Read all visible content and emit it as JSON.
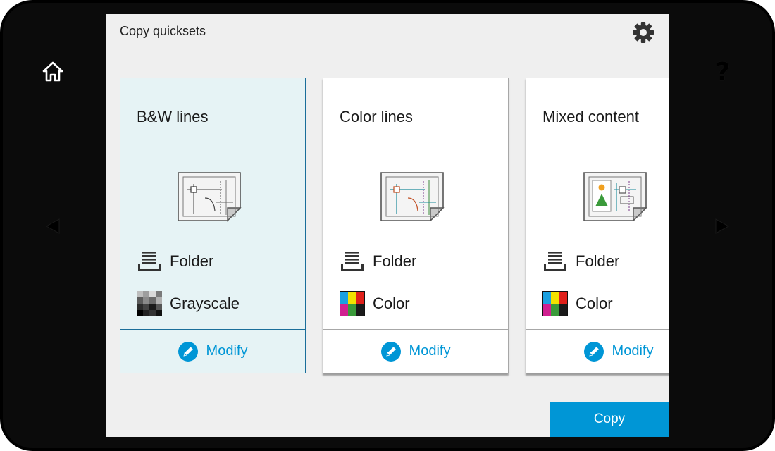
{
  "header": {
    "title": "Copy quicksets",
    "settings_icon": "gear-icon"
  },
  "side": {
    "home_icon": "home-icon",
    "help_label": "?",
    "prev_icon": "left-arrow-icon",
    "next_icon": "right-arrow-icon"
  },
  "cards": [
    {
      "title": "B&W lines",
      "thumbnail": "bw-lines-drawing-icon",
      "output": "Folder",
      "color_mode": "Grayscale",
      "modify_label": "Modify",
      "selected": true
    },
    {
      "title": "Color lines",
      "thumbnail": "color-lines-drawing-icon",
      "output": "Folder",
      "color_mode": "Color",
      "modify_label": "Modify",
      "selected": false
    },
    {
      "title": "Mixed content",
      "thumbnail": "mixed-content-drawing-icon",
      "output": "Folder",
      "color_mode": "Color",
      "modify_label": "Modify",
      "selected": false
    }
  ],
  "footer": {
    "copy_label": "Copy"
  },
  "colors": {
    "accent": "#0096d6",
    "selected_bg": "#e6f3f5",
    "selected_border": "#1a6e9a"
  }
}
